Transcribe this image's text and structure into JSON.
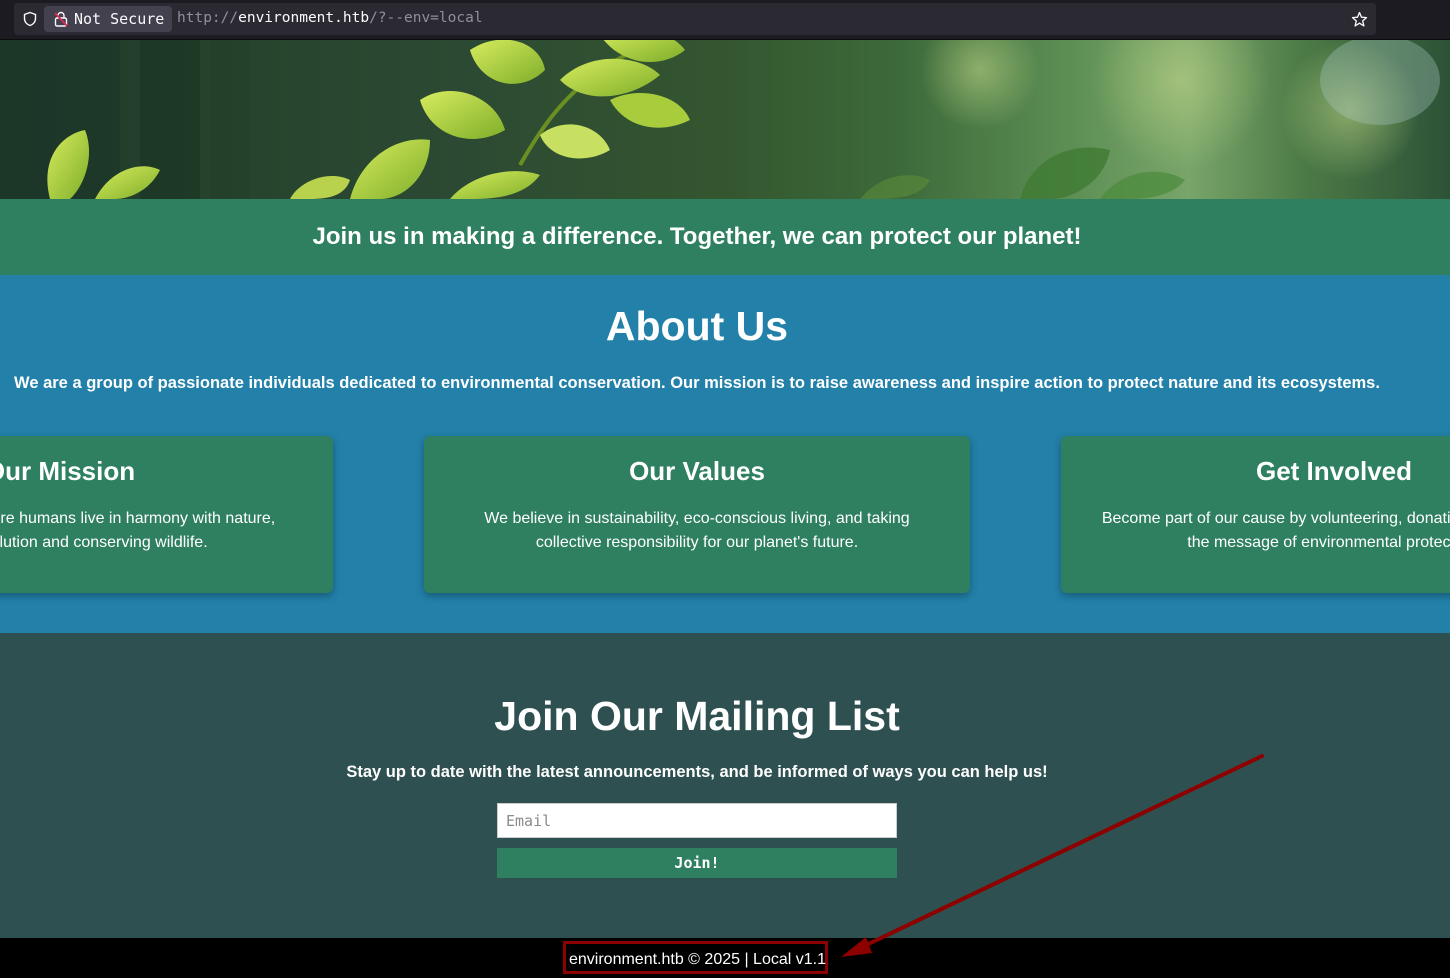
{
  "browser": {
    "security_label": "Not Secure",
    "url_scheme": "http://",
    "url_host": "environment.htb",
    "url_rest": "/?--env=local"
  },
  "banner": {
    "text": "Join us in making a difference. Together, we can protect our planet!"
  },
  "about": {
    "title": "About Us",
    "description": "We are a group of passionate individuals dedicated to environmental conservation. Our mission is to raise awareness and inspire action to protect nature and its ecosystems.",
    "cards": [
      {
        "title": "Our Mission",
        "text": "To create a world where humans live in harmony with nature, reducing pollution and conserving wildlife."
      },
      {
        "title": "Our Values",
        "text": "We believe in sustainability, eco-conscious living, and taking collective responsibility for our planet's future."
      },
      {
        "title": "Get Involved",
        "text": "Become part of our cause by volunteering, donating, or spreading the message of environmental protection."
      }
    ]
  },
  "mailing": {
    "title": "Join Our Mailing List",
    "subtitle": "Stay up to date with the latest announcements, and be informed of ways you can help us!",
    "email_placeholder": "Email",
    "button_label": "Join!"
  },
  "footer": {
    "text": "environment.htb © 2025 | Local v1.1"
  },
  "colors": {
    "banner": "#2e8060",
    "about_bg": "#2280a9",
    "mailing_bg": "#2f5051",
    "annotation": "#8c0000"
  }
}
